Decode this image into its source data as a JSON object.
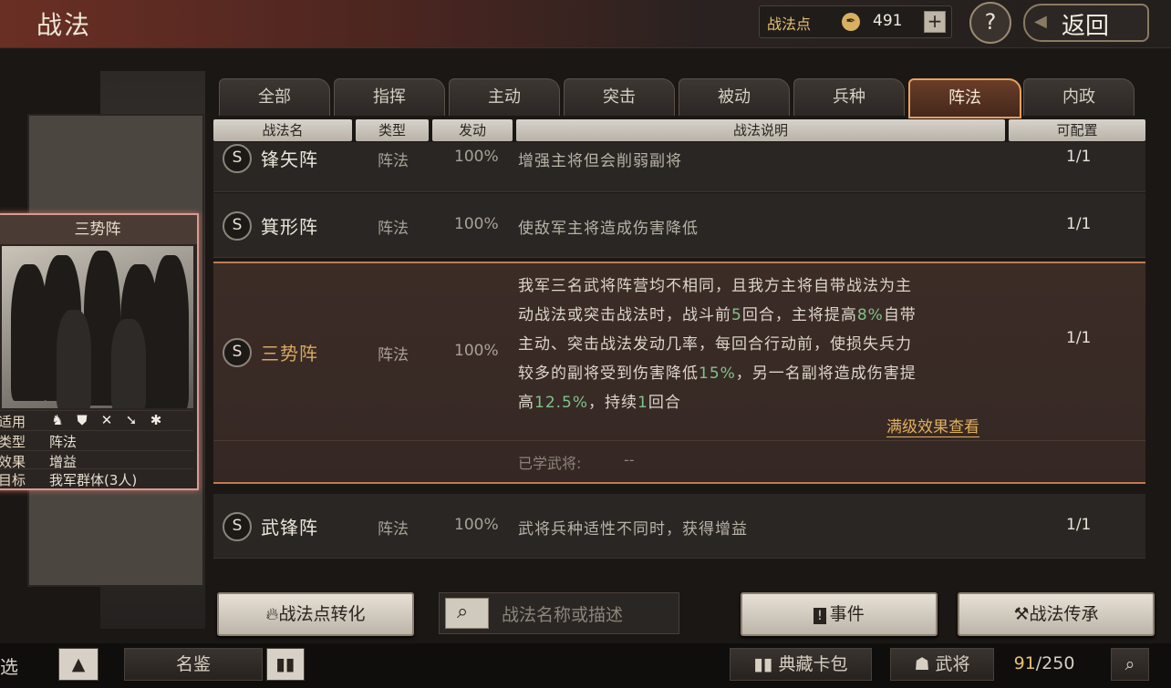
{
  "header": {
    "title": "战法",
    "points_label": "战法点",
    "points_value": "491",
    "add_label": "+",
    "help_label": "?",
    "back_label": "返回"
  },
  "card": {
    "title": "三势阵",
    "rows": [
      {
        "key": "适用",
        "value": ""
      },
      {
        "key": "类型",
        "value": "阵法"
      },
      {
        "key": "效果",
        "value": "增益"
      },
      {
        "key": "目标",
        "value": "我军群体(3人)"
      }
    ],
    "troop_icons": [
      "cavalry-icon",
      "shield-icon",
      "bow-icon",
      "spear-icon",
      "wheel-icon"
    ]
  },
  "tabs": [
    "全部",
    "指挥",
    "主动",
    "突击",
    "被动",
    "兵种",
    "阵法",
    "内政"
  ],
  "active_tab": 6,
  "columns": [
    "战法名",
    "类型",
    "发动",
    "战法说明",
    "可配置"
  ],
  "rows": [
    {
      "badge": "S",
      "name": "锋矢阵",
      "type": "阵法",
      "rate": "100%",
      "desc": "增强主将但会削弱副将",
      "cap": "1/1"
    },
    {
      "badge": "S",
      "name": "箕形阵",
      "type": "阵法",
      "rate": "100%",
      "desc": "使敌军主将造成伤害降低",
      "cap": "1/1"
    },
    {
      "badge": "S",
      "name": "三势阵",
      "type": "阵法",
      "rate": "100%",
      "cap": "1/1",
      "desc_lines": [
        [
          "我军三名武将阵营均不相同，且我方主将自带战法为主"
        ],
        [
          "动战法或突击战法时，战斗前",
          "5",
          "回合，主将提高",
          "8%",
          "自带"
        ],
        [
          "主动、突击战法发动几率，每回合行动前，使损失兵力"
        ],
        [
          "较多的副将受到伤害降低",
          "15%",
          "，另一名副将造成伤害提"
        ],
        [
          "高",
          "12.5%",
          "，持续",
          "1",
          "回合"
        ]
      ],
      "full_effect_link": "满级效果查看",
      "learned_label": "已学武将:",
      "learned_value": "--"
    },
    {
      "badge": "S",
      "name": "武锋阵",
      "type": "阵法",
      "rate": "100%",
      "desc": "武将兵种适性不同时，获得增益",
      "cap": "1/1"
    }
  ],
  "actions": {
    "convert": "战法点转化",
    "search_placeholder": "战法名称或描述",
    "events": "事件",
    "inherit": "战法传承"
  },
  "footer": {
    "filter": "选",
    "up_arrow": "▲",
    "gallery": "名鉴",
    "card_pack": "典藏卡包",
    "generals": "武将",
    "count": "91",
    "total": "/250"
  },
  "colors": {
    "accent": "#e8a060",
    "highlight": "#7ec48a",
    "gold": "#d8a860"
  }
}
